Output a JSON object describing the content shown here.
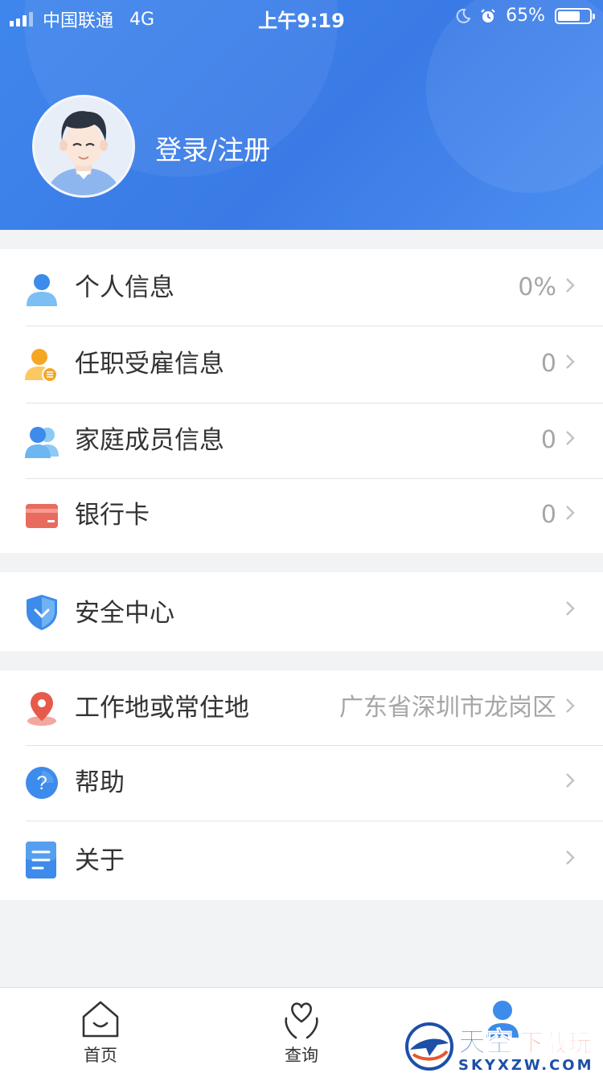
{
  "status_bar": {
    "carrier": "中国联通",
    "network": "4G",
    "time": "上午9:19",
    "battery": "65%",
    "battery_level": 0.65
  },
  "profile": {
    "login_label": "登录/注册",
    "avatar_icon": "user-avatar"
  },
  "groups": [
    {
      "items": [
        {
          "label": "个人信息",
          "value": "0%",
          "icon": "person-icon"
        },
        {
          "label": "任职受雇信息",
          "value": "0",
          "icon": "employment-icon"
        },
        {
          "label": "家庭成员信息",
          "value": "0",
          "icon": "family-icon"
        },
        {
          "label": "银行卡",
          "value": "0",
          "icon": "bank-card-icon"
        }
      ]
    },
    {
      "items": [
        {
          "label": "安全中心",
          "value": "",
          "icon": "shield-icon"
        }
      ]
    },
    {
      "items": [
        {
          "label": "工作地或常住地",
          "value": "广东省深圳市龙岗区",
          "icon": "location-icon"
        },
        {
          "label": "帮助",
          "value": "",
          "icon": "help-icon"
        },
        {
          "label": "关于",
          "value": "",
          "icon": "document-icon"
        }
      ]
    }
  ],
  "tabbar": {
    "tabs": [
      {
        "label": "首页",
        "icon": "home-icon"
      },
      {
        "label": "查询",
        "icon": "heart-hands-icon"
      },
      {
        "label": "",
        "icon": "user-icon",
        "active": true
      }
    ]
  },
  "watermark": {
    "text_main": "天空下载玩",
    "text_sub": "SKYXZW.COM"
  },
  "colors": {
    "header_blue": "#3a7ae6",
    "icon_blue": "#3d8bea",
    "orange": "#f5a623",
    "red": "#e96b5f"
  }
}
